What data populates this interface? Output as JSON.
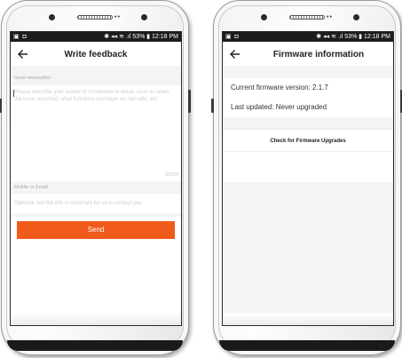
{
  "status_bar": {
    "left_icons": "▣ ◘",
    "right_text": "✱ ◂◂ ≋ .ıl 53% ▮ 12:18 PM"
  },
  "feedback_screen": {
    "title": "Write feedback",
    "back_icon": "arrow-left",
    "issue_section_label": "Issue description",
    "issue_placeholder": "Please describe your issues or complaints in detail, such as when the issue occurred, what functions you hope we can add, etc.",
    "char_counter": "0/1024",
    "contact_section_label": "Mobile or Email",
    "contact_placeholder": "Optional, but the info is important for us to contact you",
    "send_label": "Send"
  },
  "firmware_screen": {
    "title": "Firmware information",
    "back_icon": "arrow-left",
    "current_version": "Current firmware version: 2.1.7",
    "last_updated": "Last updated:  Never upgraded",
    "check_button_label": "Check for Firmware Upgrades"
  },
  "colors": {
    "accent": "#f05a1a",
    "section_band": "#f4f4f4",
    "status_bar": "#1c1c1c"
  }
}
